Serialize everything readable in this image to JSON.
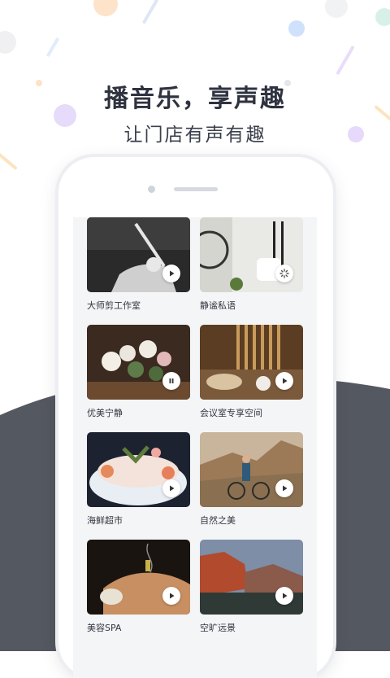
{
  "header": {
    "title": "播音乐，享声趣",
    "subtitle": "让门店有声有趣"
  },
  "colors": {
    "background": "#ffffff",
    "dark_wave": "#545861",
    "heading": "#2f3340",
    "card_label": "#333640",
    "screen_bg": "#f4f5f7"
  },
  "scenes": [
    {
      "label": "大师剪工作室",
      "status": "play",
      "icon": "play-icon"
    },
    {
      "label": "静谧私语",
      "status": "loading",
      "icon": "loading-icon"
    },
    {
      "label": "优美宁静",
      "status": "pause",
      "icon": "pause-icon"
    },
    {
      "label": "会议室专享空间",
      "status": "play",
      "icon": "play-icon"
    },
    {
      "label": "海鲜超市",
      "status": "play",
      "icon": "play-icon"
    },
    {
      "label": "自然之美",
      "status": "play",
      "icon": "play-icon"
    },
    {
      "label": "美容SPA",
      "status": "play",
      "icon": "play-icon"
    },
    {
      "label": "空旷远景",
      "status": "play",
      "icon": "play-icon"
    }
  ]
}
